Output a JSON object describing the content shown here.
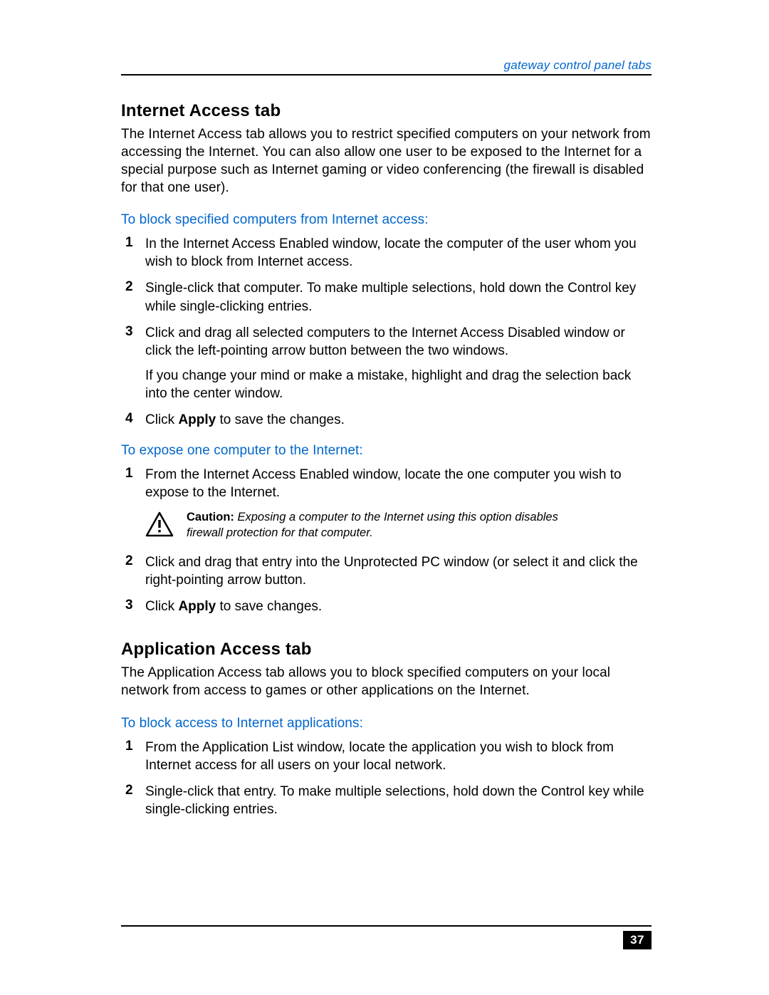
{
  "header": {
    "running_head": "gateway control panel tabs"
  },
  "section1": {
    "title": "Internet Access tab",
    "intro": "The Internet Access tab allows you to restrict specified computers on your network from accessing the Internet. You can also allow one user to be exposed to the Internet for a special purpose such as Internet gaming or video conferencing (the firewall is disabled for that one user).",
    "sub1": "To block specified computers from Internet access:",
    "steps1": {
      "n1": "1",
      "t1": "In the Internet Access Enabled window, locate the computer of the user whom you wish to block from Internet access.",
      "n2": "2",
      "t2": "Single-click that computer. To make multiple selections, hold down the Control key while single-clicking entries.",
      "n3": "3",
      "t3a": "Click and drag all selected computers to the Internet Access Disabled window or click the left-pointing arrow button between the two windows.",
      "t3b": "If you change your mind or make a mistake, highlight and drag the selection back into the center window.",
      "n4": "4",
      "t4_pre": "Click ",
      "t4_bold": "Apply",
      "t4_post": " to save the changes."
    },
    "sub2": "To expose one computer to the Internet:",
    "steps2": {
      "n1": "1",
      "t1": "From the Internet Access Enabled window, locate the one computer you wish to expose to the Internet.",
      "caution_label": "Caution:",
      "caution_text": " Exposing a computer to the Internet using this option disables firewall protection for that computer.",
      "n2": "2",
      "t2": "Click and drag that entry into the Unprotected PC window (or select it and click the right-pointing arrow button.",
      "n3": "3",
      "t3_pre": "Click ",
      "t3_bold": "Apply",
      "t3_post": " to save changes."
    }
  },
  "section2": {
    "title": "Application Access tab",
    "intro": "The Application Access tab allows you to block specified computers on your local network from access to games or other applications on the Internet.",
    "sub1": "To block access to Internet applications:",
    "steps1": {
      "n1": "1",
      "t1": "From the Application List window, locate the application you wish to block from Internet access for all users on your local network.",
      "n2": "2",
      "t2": "Single-click that entry. To make multiple selections, hold down the Control key while single-clicking entries."
    }
  },
  "footer": {
    "page_number": "37"
  }
}
